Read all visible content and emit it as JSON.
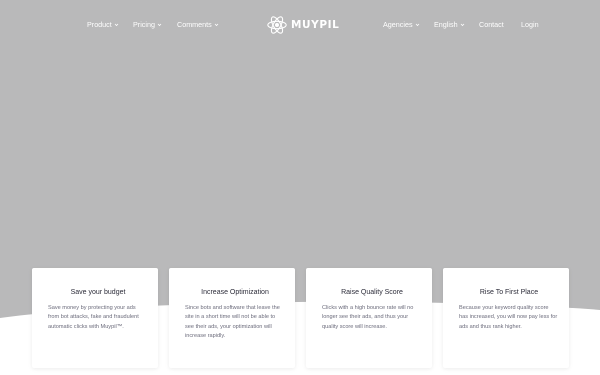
{
  "nav": {
    "left": [
      {
        "label": "Product",
        "has_dropdown": true
      },
      {
        "label": "Pricing",
        "has_dropdown": true
      },
      {
        "label": "Comments",
        "has_dropdown": true
      }
    ],
    "logo": {
      "text": "MUYPIL",
      "icon": "atom-logo-icon"
    },
    "right": [
      {
        "label": "Agencies",
        "has_dropdown": true
      },
      {
        "label": "English",
        "has_dropdown": true
      },
      {
        "label": "Contact",
        "has_dropdown": false
      },
      {
        "label": "Login",
        "has_dropdown": false
      }
    ]
  },
  "cards": [
    {
      "title": "Save your budget",
      "text": "Save money by protecting your ads from bot attacks, fake and fraudulent automatic clicks with Muypil™."
    },
    {
      "title": "Increase Optimization",
      "text": "Since bots and software that leave the site in a short time will not be able to see their ads, your optimization will increase rapidly."
    },
    {
      "title": "Raise Quality Score",
      "text": "Clicks with a high bounce rate will no longer see their ads, and thus your quality score will increase."
    },
    {
      "title": "Rise To First Place",
      "text": "Because your keyword quality score has increased, you will now pay less for ads and thus rank higher."
    }
  ],
  "colors": {
    "hero_bg": "#b9b9ba",
    "card_bg": "#ffffff",
    "text_dark": "#2d2d3a",
    "text_muted": "#6b6b7b"
  }
}
